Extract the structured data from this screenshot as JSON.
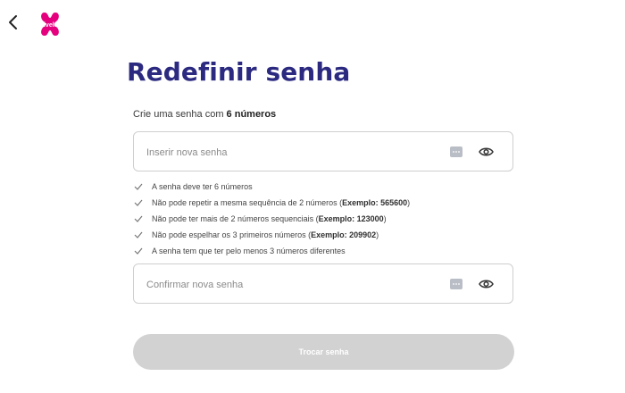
{
  "header": {
    "back_icon": "chevron-left-icon",
    "logo_text": "livelo",
    "logo_color": "#e5007e"
  },
  "title": "Redefinir senha",
  "subtitle": {
    "prefix": "Crie uma senha com ",
    "bold": "6 números"
  },
  "new_password": {
    "placeholder": "Inserir nova senha",
    "value": "",
    "password_manager_icon": "password-dots-icon",
    "toggle_icon": "eye-icon"
  },
  "rules": [
    {
      "text": "A senha deve ter 6 números",
      "example": ""
    },
    {
      "text": "Não pode repetir a mesma sequência de 2 números (",
      "example": "Exemplo: 565600",
      "suffix": ")"
    },
    {
      "text": "Não pode ter mais de 2 números sequenciais (",
      "example": "Exemplo: 123000",
      "suffix": ")"
    },
    {
      "text": "Não pode espelhar os 3 primeiros números (",
      "example": "Exemplo: 209902",
      "suffix": ")"
    },
    {
      "text": "A senha tem que ter pelo menos 3 números diferentes",
      "example": ""
    }
  ],
  "confirm_password": {
    "placeholder": "Confirmar nova senha",
    "value": "",
    "password_manager_icon": "password-dots-icon",
    "toggle_icon": "eye-icon"
  },
  "submit": {
    "label": "Trocar senha",
    "enabled": false
  },
  "colors": {
    "title": "#2b2a80",
    "button_disabled": "#d2d2d2",
    "border": "#cfcfcf"
  }
}
